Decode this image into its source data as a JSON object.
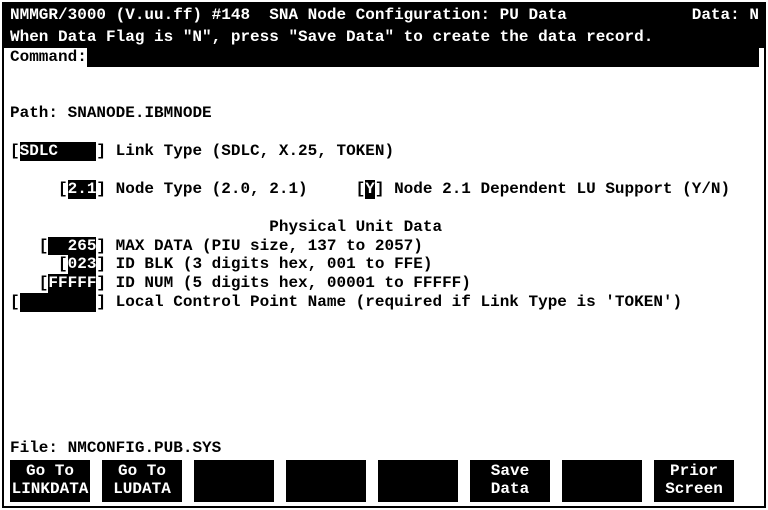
{
  "header": {
    "left": "NMMGR/3000 (V.uu.ff) #148  SNA Node Configuration: PU Data",
    "data_label": "Data:",
    "data_value": "N",
    "hint": "When Data Flag is \"N\", press \"Save Data\" to create the data record."
  },
  "command": {
    "label": "Command:",
    "value": "                                                                      "
  },
  "path": {
    "label": "Path:",
    "value": "SNANODE.IBMNODE"
  },
  "fields": {
    "link_type": {
      "value": "SDLC    ",
      "label": "Link Type (SDLC, X.25, TOKEN)"
    },
    "node_type": {
      "value": "2.1",
      "label": "Node Type (2.0, 2.1)"
    },
    "dep_lu": {
      "value": "Y",
      "label": "Node 2.1 Dependent LU Support (Y/N)"
    },
    "max_data": {
      "value": "  265",
      "label": "MAX DATA (PIU size, 137 to 2057)"
    },
    "id_blk": {
      "value": "023",
      "label": "ID BLK (3 digits hex, 001 to FFE)"
    },
    "id_num": {
      "value": "FFFFF",
      "label": "ID NUM (5 digits hex, 00001 to FFFFF)"
    },
    "lcpn": {
      "value": "        ",
      "label": "Local Control Point Name (required if Link Type is 'TOKEN')"
    }
  },
  "section_title": "Physical Unit Data",
  "file": {
    "label": "File:",
    "value": "NMCONFIG.PUB.SYS"
  },
  "fkeys": {
    "f1": {
      "l1": "Go To",
      "l2": "LINKDATA"
    },
    "f2": {
      "l1": "Go To",
      "l2": "LUDATA"
    },
    "f6": {
      "l1": "Save",
      "l2": "Data"
    },
    "f8": {
      "l1": "Prior",
      "l2": "Screen"
    }
  }
}
